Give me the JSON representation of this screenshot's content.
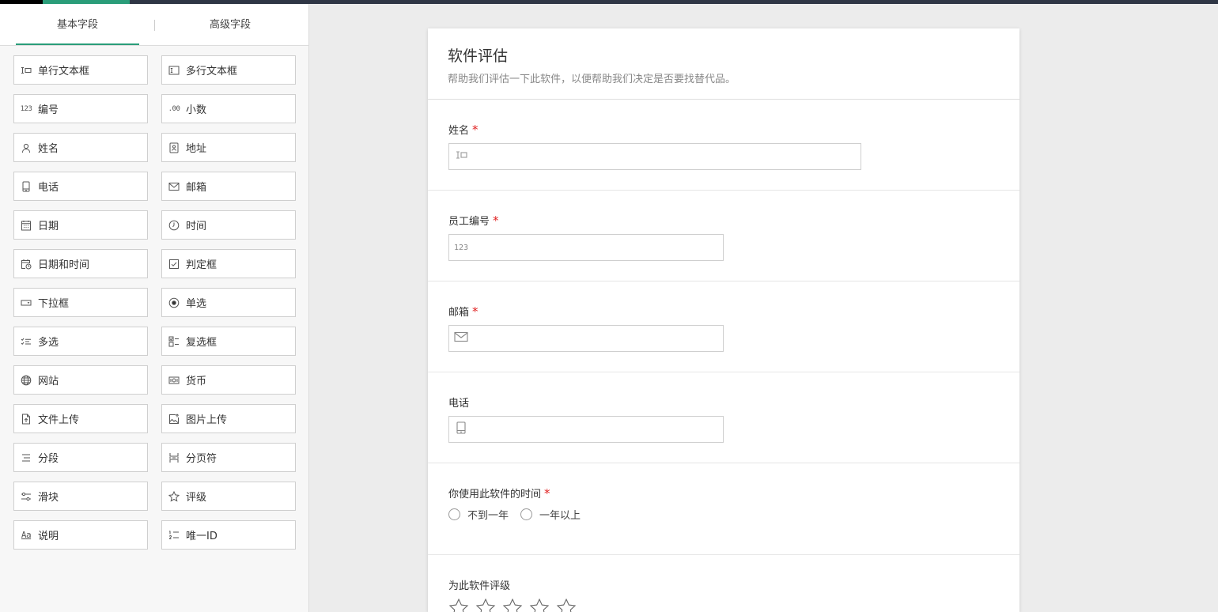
{
  "sidebar": {
    "tabs": [
      {
        "label": "基本字段",
        "active": true
      },
      {
        "label": "高级字段",
        "active": false
      }
    ],
    "fields": [
      {
        "label": "单行文本框",
        "icon": "single-line-text-icon"
      },
      {
        "label": "多行文本框",
        "icon": "multi-line-text-icon"
      },
      {
        "label": "编号",
        "icon": "number-icon",
        "icon_text": "123"
      },
      {
        "label": "小数",
        "icon": "decimal-icon",
        "icon_text": ".00"
      },
      {
        "label": "姓名",
        "icon": "person-icon"
      },
      {
        "label": "地址",
        "icon": "address-icon"
      },
      {
        "label": "电话",
        "icon": "phone-icon"
      },
      {
        "label": "邮箱",
        "icon": "mail-icon"
      },
      {
        "label": "日期",
        "icon": "calendar-icon"
      },
      {
        "label": "时间",
        "icon": "clock-icon"
      },
      {
        "label": "日期和时间",
        "icon": "datetime-icon"
      },
      {
        "label": "判定框",
        "icon": "checkbox-icon"
      },
      {
        "label": "下拉框",
        "icon": "dropdown-icon"
      },
      {
        "label": "单选",
        "icon": "radio-icon"
      },
      {
        "label": "多选",
        "icon": "multi-select-icon"
      },
      {
        "label": "复选框",
        "icon": "checklist-icon"
      },
      {
        "label": "网站",
        "icon": "globe-icon"
      },
      {
        "label": "货币",
        "icon": "currency-icon"
      },
      {
        "label": "文件上传",
        "icon": "file-upload-icon"
      },
      {
        "label": "图片上传",
        "icon": "image-upload-icon"
      },
      {
        "label": "分段",
        "icon": "section-icon"
      },
      {
        "label": "分页符",
        "icon": "page-break-icon"
      },
      {
        "label": "滑块",
        "icon": "slider-icon"
      },
      {
        "label": "评级",
        "icon": "star-icon"
      },
      {
        "label": "说明",
        "icon": "description-icon",
        "icon_text": "Aa"
      },
      {
        "label": "唯一ID",
        "icon": "unique-id-icon"
      }
    ]
  },
  "form": {
    "title": "软件评估",
    "description": "帮助我们评估一下此软件，以便帮助我们决定是否要找替代品。",
    "questions": {
      "name": {
        "label": "姓名",
        "required": true,
        "required_mark": "*"
      },
      "employee_id": {
        "label": "员工编号",
        "required": true,
        "required_mark": "*",
        "icon_text": "123"
      },
      "email": {
        "label": "邮箱",
        "required": true,
        "required_mark": "*"
      },
      "phone": {
        "label": "电话",
        "required": false
      },
      "usage_time": {
        "label": "你使用此软件的时间",
        "required": true,
        "required_mark": "*",
        "options": [
          "不到一年",
          "一年以上"
        ]
      },
      "rating": {
        "label": "为此软件评级",
        "stars": 5
      }
    }
  },
  "colors": {
    "accent": "#2a9d79",
    "required": "#e02020",
    "topbar": "#2f3645"
  }
}
